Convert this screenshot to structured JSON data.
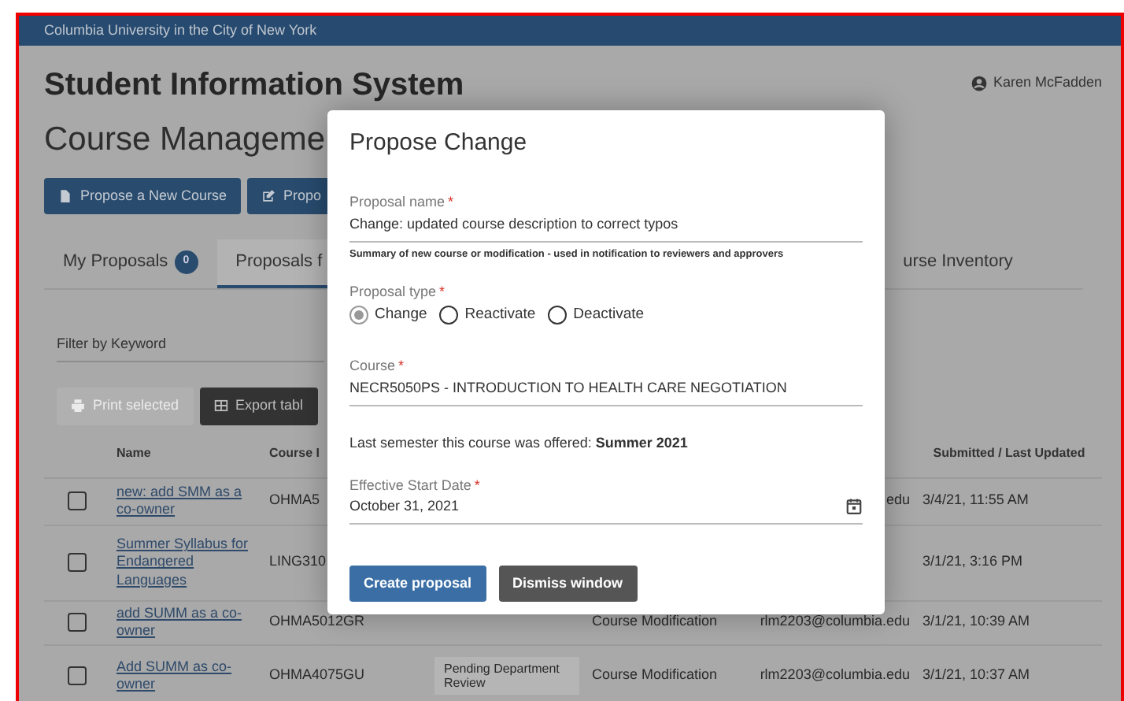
{
  "top_bar": {
    "title": "Columbia University in the City of New York"
  },
  "header": {
    "app_title": "Student Information System",
    "user": "Karen McFadden",
    "page_title": "Course Manageme"
  },
  "actions": [
    {
      "label": "Propose a New Course",
      "kind": "file"
    },
    {
      "label": "Propo",
      "kind": "edit"
    }
  ],
  "tabs": [
    {
      "label": "My Proposals",
      "badge": "0",
      "selected": false
    },
    {
      "label": "Proposals f",
      "selected": true
    },
    {
      "label": "urse Inventory",
      "selected": false
    }
  ],
  "filter": {
    "placeholder": "Filter by Keyword"
  },
  "table_buttons": [
    {
      "label": "Print selected",
      "kind": "printer",
      "disabled": true
    },
    {
      "label": "Export tabl",
      "kind": "table",
      "disabled": false
    }
  ],
  "table": {
    "columns": [
      "Name",
      "Course I",
      "Submitted / Last Updated"
    ],
    "rows": [
      {
        "checked": false,
        "name": "new: add SMM as a co-owner",
        "course_id": "OHMA5",
        "email": "edu",
        "date": "3/4/21, 11:55 AM"
      },
      {
        "checked": false,
        "name": "Summer Syllabus for Endangered Languages",
        "course_id": "LING310",
        "date": "3/1/21, 3:16 PM"
      },
      {
        "checked": false,
        "name": "add SUMM as a co-owner",
        "course_id": "OHMA5012GR",
        "type": "Course Modification",
        "email": "rlm2203@columbia.edu",
        "date": "3/1/21, 10:39 AM"
      },
      {
        "checked": false,
        "name": "Add SUMM as co-owner",
        "course_id": "OHMA4075GU",
        "status": "Pending Department Review",
        "type": "Course Modification",
        "email": "rlm2203@columbia.edu",
        "date": "3/1/21, 10:37 AM"
      }
    ]
  },
  "modal": {
    "title": "Propose Change",
    "proposal_name": {
      "label": "Proposal name",
      "required_mark": "*",
      "value": "Change: updated course description to correct typos",
      "help": "Summary of new course or modification - used in notification to reviewers and approvers"
    },
    "proposal_type": {
      "label": "Proposal type",
      "required_mark": "*",
      "options": [
        {
          "label": "Change",
          "selected": true
        },
        {
          "label": "Reactivate",
          "selected": false
        },
        {
          "label": "Deactivate",
          "selected": false
        }
      ]
    },
    "course": {
      "label": "Course",
      "required_mark": "*",
      "value": "NECR5050PS - INTRODUCTION TO HEALTH CARE NEGOTIATION"
    },
    "last_offered": "Last semester this course was offered: **Summer 2021**",
    "start_date": {
      "label": "Effective Start Date",
      "required_mark": "*",
      "value": "October 31, 2021"
    },
    "buttons": [
      {
        "label": "Create proposal",
        "kind": "primary"
      },
      {
        "label": "Dismiss window",
        "kind": "secondary"
      }
    ]
  }
}
